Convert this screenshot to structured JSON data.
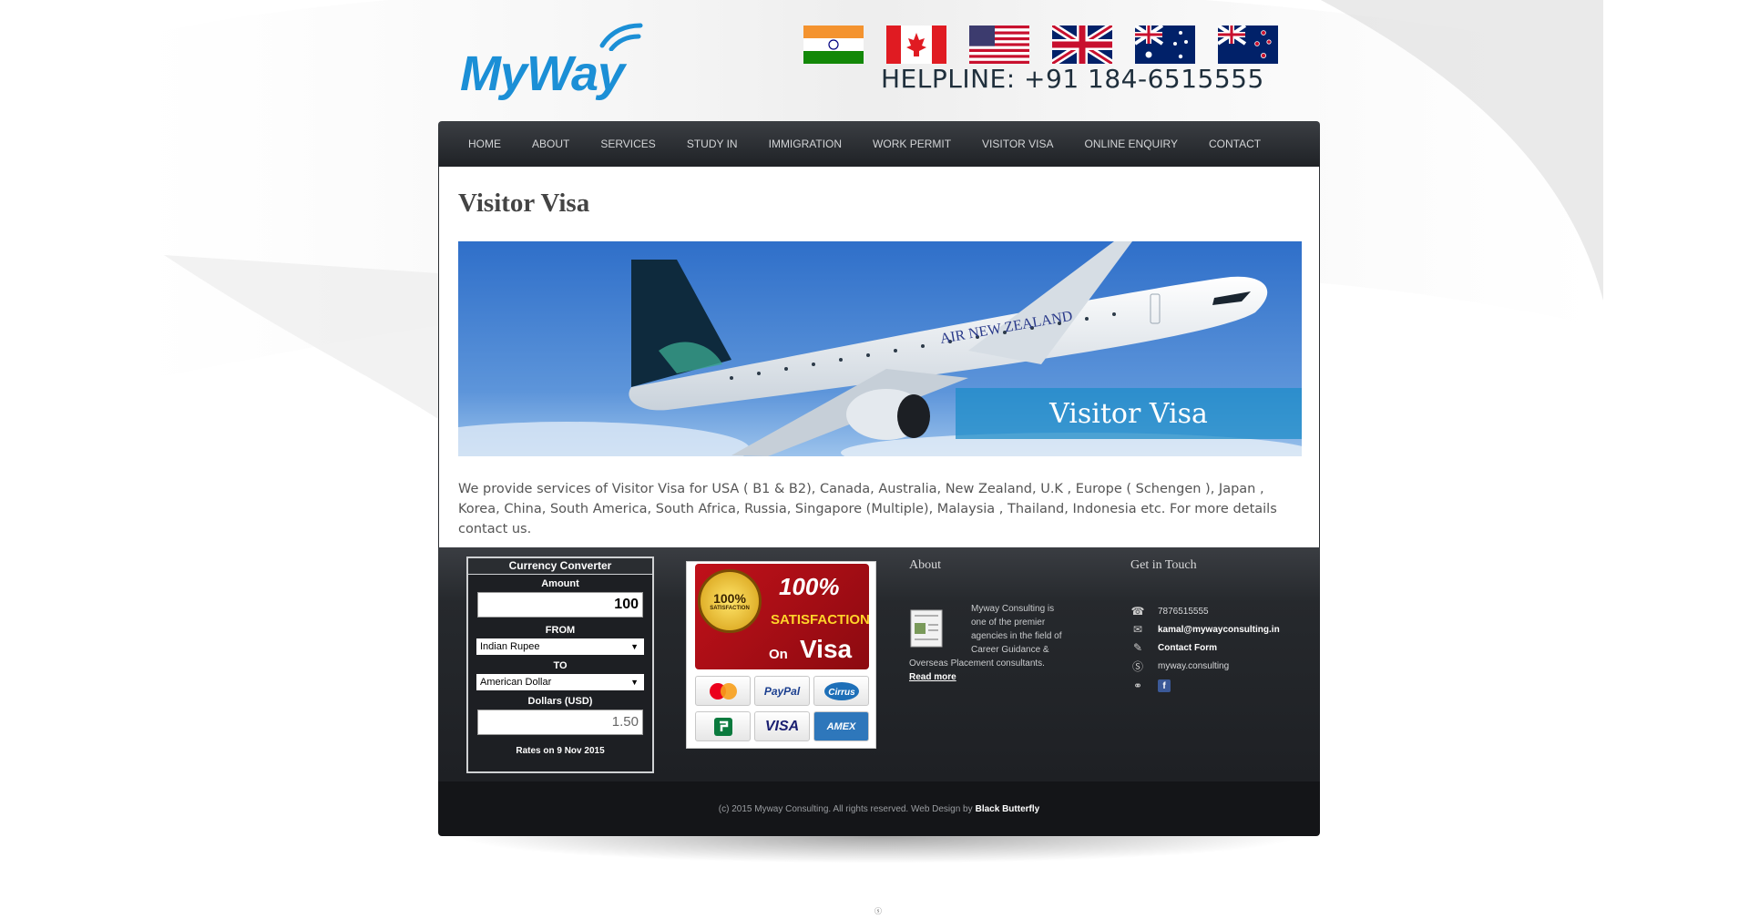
{
  "brand": {
    "logo_text": "MyWay"
  },
  "header": {
    "flags": [
      "india-flag-icon",
      "canada-flag-icon",
      "usa-flag-icon",
      "uk-flag-icon",
      "australia-flag-icon",
      "new-zealand-flag-icon"
    ],
    "helpline": "HELPLINE: +91 184-6515555"
  },
  "nav": {
    "items": [
      "HOME",
      "ABOUT",
      "SERVICES",
      "STUDY IN",
      "IMMIGRATION",
      "WORK PERMIT",
      "VISITOR VISA",
      "ONLINE ENQUIRY",
      "CONTACT"
    ]
  },
  "main": {
    "title": "Visitor Visa",
    "banner": {
      "airline_text": "AIR NEW ZEALAND",
      "label": "Visitor Visa"
    },
    "description": "We provide services of Visitor Visa for USA ( B1 & B2), Canada, Australia, New Zealand, U.K , Europe ( Schengen ), Japan , Korea, China, South America, South Africa, Russia, Singapore (Multiple), Malaysia , Thailand, Indonesia etc. For more details contact us."
  },
  "currency_converter": {
    "title": "Currency Converter",
    "amount_label": "Amount",
    "amount_value": "100",
    "from_label": "FROM",
    "from_value": "Indian Rupee",
    "to_label": "TO",
    "to_value": "American Dollar",
    "result_label": "Dollars (USD)",
    "result_value": "1.50",
    "rates_prefix": "Rates on",
    "rates_date": "9 Nov 2015"
  },
  "satisfaction": {
    "seal_percent": "100%",
    "seal_text": "SATISFACTION",
    "percent": "100%",
    "word": "SATISFACTION",
    "on": "On",
    "visa": "Visa",
    "cards": [
      "MasterCard",
      "PayPal",
      "Cirrus",
      "Credit",
      "VISA",
      "AMEX"
    ]
  },
  "about": {
    "title": "About",
    "text_lines": [
      "Myway Consulting is",
      "one of the premier",
      "agencies in the field of",
      "Career Guidance &"
    ],
    "text_last": "Overseas Placement consultants.",
    "read_more": "Read more"
  },
  "contact": {
    "title": "Get in Touch",
    "phone": "7876515555",
    "email": "kamal@mywayconsulting.in",
    "form": "Contact Form",
    "skype": "myway.consulting",
    "facebook_letter": "f"
  },
  "footer": {
    "copyright": "(c) 2015 Myway Consulting. All rights reserved. Web Design by",
    "designer": "Black Butterfly"
  },
  "misc": {
    "bottom_glyph": "ⓢ"
  }
}
